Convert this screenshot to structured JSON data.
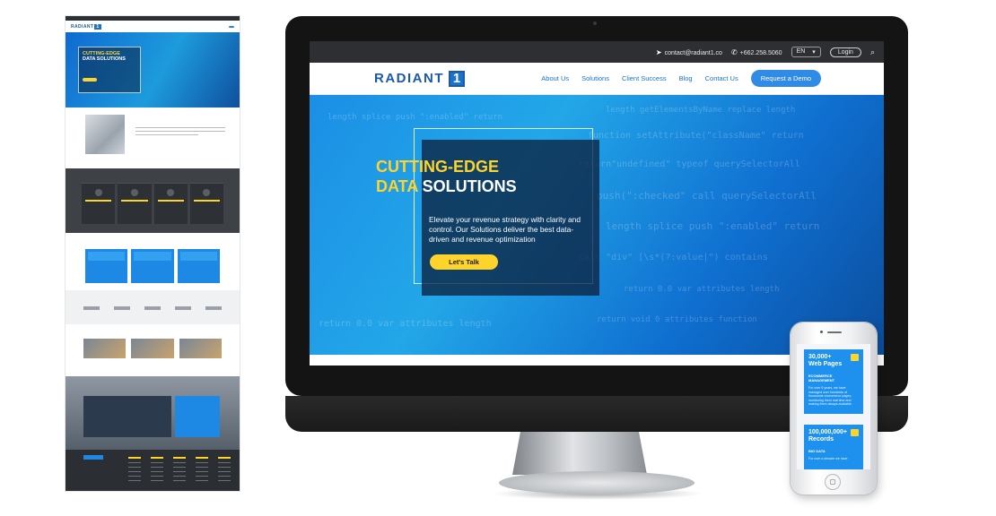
{
  "monitor_site": {
    "topbar": {
      "email": "contact@radiant1.co",
      "phone": "+662.258.5060",
      "language": "EN",
      "login": "Login"
    },
    "navbar": {
      "logo_text": "RADIANT",
      "logo_number": "1",
      "menu": [
        "About Us",
        "Solutions",
        "Client Success",
        "Blog",
        "Contact Us"
      ],
      "cta": "Request a Demo"
    },
    "hero": {
      "title_line1_yellow": "CUTTING-EDGE",
      "title_line2_yellow": "DATA",
      "title_line2_white": "SOLUTIONS",
      "description": "Elevate your revenue strategy with clarity and control. Our Solutions deliver the best data-driven and revenue optimization",
      "button": "Let's Talk"
    },
    "code_background": [
      "length  getElementsByName   replace   length",
      "function  setAttribute(\"className\"  return",
      "return\"undefined\"  typeof  querySelectorAll",
      "push(\":checked\"   call   querySelectorAll",
      "length   splice   push   \":enabled\"   return",
      "call  \"div\"   [\\s*(?:value|\")   contains",
      "return   0.0  var   attributes   length",
      "return  void 0   attributes   function"
    ]
  },
  "phone_site": {
    "cards": [
      {
        "number": "30,000+",
        "label": "Web Pages",
        "subtitle": "ECOMMERCE MANAGEMENT",
        "text": "For over 5 years, we have managed over hundreds of thousands ecommerce pages, monitoring them real time and making them always available."
      },
      {
        "number": "100,000,000+",
        "label": "Records",
        "subtitle": "BIG DATA",
        "text": "For over a decade we have"
      }
    ]
  },
  "thumbnail": {
    "logo_text": "RADIANT",
    "logo_number": "1",
    "hero_line1": "CUTTING-EDGE",
    "hero_line2": "DATA SOLUTIONS"
  },
  "colors": {
    "brand_blue": "#1a73c8",
    "accent_yellow": "#ffd42a",
    "topbar_dark": "#2d2f32"
  }
}
